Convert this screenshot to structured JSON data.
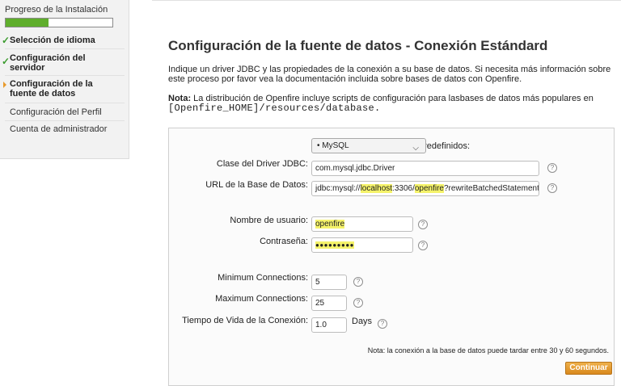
{
  "sidebar": {
    "progress_title": "Progreso de la Instalación",
    "progress_fraction": 0.4,
    "steps": [
      {
        "label": "Selección de idioma",
        "state": "done"
      },
      {
        "label": "Configuración del servidor",
        "state": "done"
      },
      {
        "label": "Configuración de la fuente de datos",
        "state": "current"
      },
      {
        "label": "Configuración del Perfil",
        "state": "pending"
      },
      {
        "label": "Cuenta de administrador",
        "state": "pending"
      }
    ]
  },
  "main": {
    "title": "Configuración de la fuente de datos - Conexión Estándard",
    "intro": "Indique un driver JDBC y las propiedades de la conexión a su base de datos. Si necesita más información sobre este proceso por favor vea la documentación incluida sobre bases de datos con Openfire.",
    "note_label": "Nota:",
    "note_text": "La distribución de Openfire incluye scripts de configuración para lasbases de datos más populares en",
    "note_path": "[Openfire_HOME]/resources/database."
  },
  "form": {
    "drivers_label": "Drivers Predefinidos:",
    "drivers_value": "• MySQL",
    "driver_class_label": "Clase del Driver JDBC:",
    "driver_class_value": "com.mysql.jdbc.Driver",
    "db_url_label": "URL de la Base de Datos:",
    "db_url_prefix": "jdbc:mysql://",
    "db_url_host": "localhost",
    "db_url_mid": ":3306/",
    "db_url_db": "openfire",
    "db_url_suffix": "?rewriteBatchedStatements",
    "username_label": "Nombre de usuario:",
    "username_value": "openfire",
    "password_label": "Contraseña:",
    "password_value": "●●●●●●●●●",
    "min_conn_label": "Minimum Connections:",
    "min_conn_value": "5",
    "max_conn_label": "Maximum Connections:",
    "max_conn_value": "25",
    "lifetime_label": "Tiempo de Vida de la Conexión:",
    "lifetime_value": "1.0",
    "lifetime_unit": "Days",
    "footer_note": "Nota: la conexión a la base de datos puede tardar entre 30 y 60 segundos.",
    "continue_label": "Continuar",
    "help_glyph": "?"
  },
  "colors": {
    "progress": "#5fae2c",
    "check": "#3b9b2e",
    "current_arrow": "#e89a2c",
    "highlight": "#f5f36a",
    "button": "#e39a2f"
  }
}
